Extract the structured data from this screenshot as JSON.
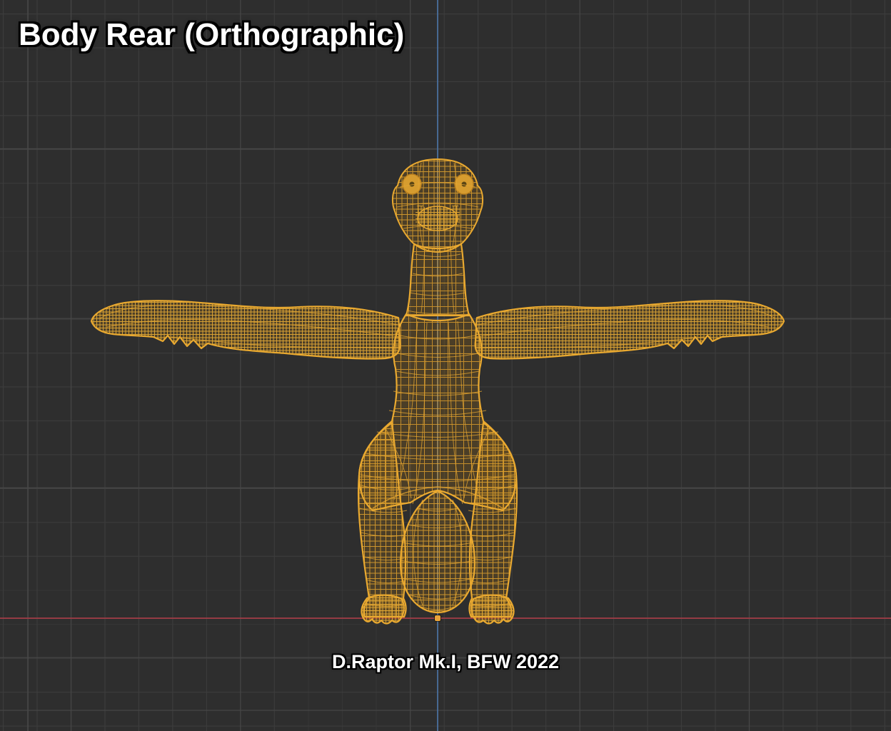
{
  "header": {
    "title": "Body Rear (Orthographic)"
  },
  "footer": {
    "caption": "D.Raptor Mk.I, BFW 2022"
  },
  "viewport": {
    "view": "Body Rear",
    "projection": "Orthographic",
    "colors": {
      "background": "#2e2e2e",
      "grid_minor": "#3c3c3c",
      "grid_major": "#474747",
      "axis_x_red": "#9a3c46",
      "axis_z_blue": "#4a6f9d",
      "wireframe_orange": "#d79a28",
      "wireframe_edge": "#e9a930",
      "origin_dot": "#e8a33a",
      "text_fill": "#ffffff",
      "text_outline": "#000000"
    }
  }
}
